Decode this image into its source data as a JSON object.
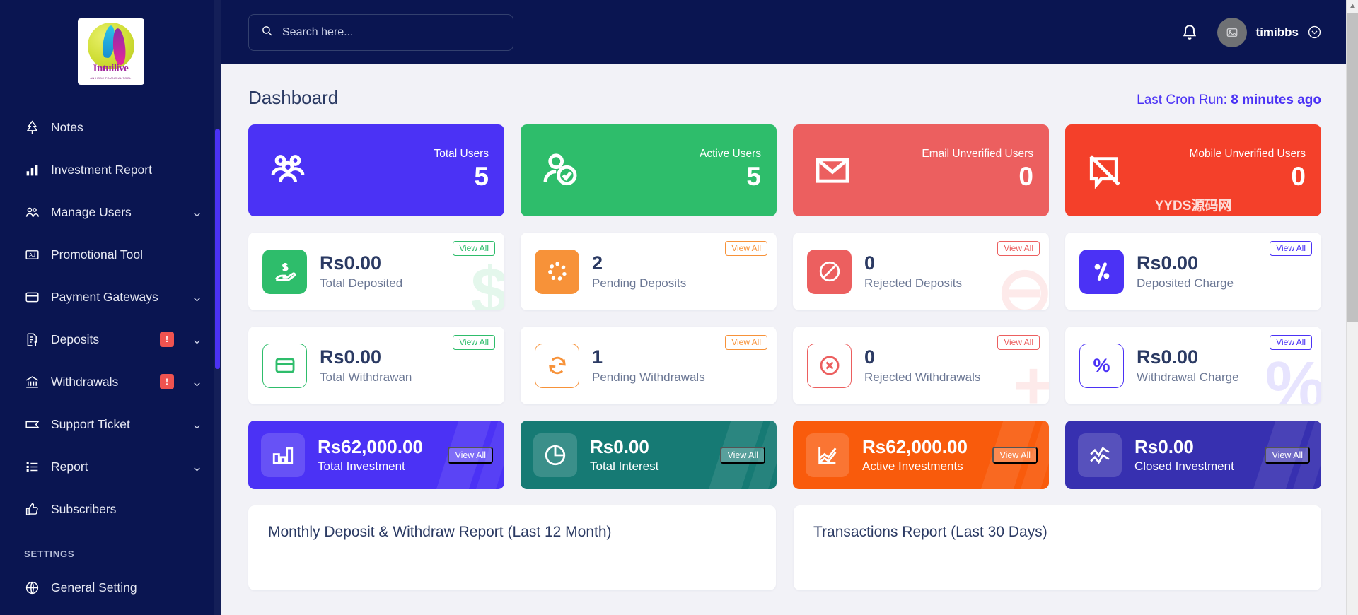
{
  "brand": {
    "logo_text": "Intuilive",
    "logo_sub": "AN HSBC FINANCIAL TOOL"
  },
  "sidebar": {
    "items": [
      {
        "label": "Notes",
        "icon": "tree-icon",
        "badge": null,
        "chevron": false
      },
      {
        "label": "Investment Report",
        "icon": "bar-chart-icon",
        "badge": null,
        "chevron": false
      },
      {
        "label": "Manage Users",
        "icon": "users-icon",
        "badge": null,
        "chevron": true
      },
      {
        "label": "Promotional Tool",
        "icon": "ad-icon",
        "badge": null,
        "chevron": false
      },
      {
        "label": "Payment Gateways",
        "icon": "credit-card-icon",
        "badge": null,
        "chevron": true
      },
      {
        "label": "Deposits",
        "icon": "document-dollar-icon",
        "badge": "!",
        "chevron": true
      },
      {
        "label": "Withdrawals",
        "icon": "bank-icon",
        "badge": "!",
        "chevron": true
      },
      {
        "label": "Support Ticket",
        "icon": "ticket-icon",
        "badge": null,
        "chevron": true
      },
      {
        "label": "Report",
        "icon": "list-icon",
        "badge": null,
        "chevron": true
      },
      {
        "label": "Subscribers",
        "icon": "thumbs-up-icon",
        "badge": null,
        "chevron": false
      }
    ],
    "section_label": "SETTINGS",
    "settings_items": [
      {
        "label": "General Setting",
        "icon": "globe-icon",
        "badge": null,
        "chevron": false
      }
    ]
  },
  "topbar": {
    "search_placeholder": "Search here...",
    "search_value": "",
    "username": "timibbs"
  },
  "page": {
    "title": "Dashboard",
    "cron_label": "Last Cron Run:",
    "cron_value": "8 minutes ago",
    "watermark": "YYDS源码网"
  },
  "colors": {
    "accent": "#4b32f5",
    "sidebar": "#0a1551",
    "green": "#2ebd6b",
    "orange": "#f79239",
    "red": "#ef5350",
    "red_strong": "#f4402a",
    "teal": "#167a74",
    "indigo": "#3730b0"
  },
  "stat_cards_row1": [
    {
      "label": "Total Users",
      "value": "5",
      "icon": "group-users-icon",
      "bg": "#4b32f5"
    },
    {
      "label": "Active Users",
      "value": "5",
      "icon": "user-check-icon",
      "bg": "#2ebd6b"
    },
    {
      "label": "Email Unverified Users",
      "value": "0",
      "icon": "envelope-icon",
      "bg": "#ec5f5f"
    },
    {
      "label": "Mobile Unverified Users",
      "value": "0",
      "icon": "mobile-off-icon",
      "bg": "#f4402a"
    }
  ],
  "stat_cards_row2": [
    {
      "value": "Rs0.00",
      "label": "Total Deposited",
      "view_all": "View All",
      "icon": "hand-dollar-icon",
      "color": "#2ebd6b",
      "filled": true,
      "ghost": "$"
    },
    {
      "value": "2",
      "label": "Pending Deposits",
      "view_all": "View All",
      "icon": "spinner-icon",
      "color": "#f79239",
      "filled": true,
      "ghost": ""
    },
    {
      "value": "0",
      "label": "Rejected Deposits",
      "view_all": "View All",
      "icon": "ban-icon",
      "color": "#ec5f5f",
      "filled": true,
      "ghost": "⊖"
    },
    {
      "value": "Rs0.00",
      "label": "Deposited Charge",
      "view_all": "View All",
      "icon": "percent-icon",
      "color": "#4b32f5",
      "filled": true,
      "ghost": ""
    }
  ],
  "stat_cards_row3": [
    {
      "value": "Rs0.00",
      "label": "Total Withdrawan",
      "view_all": "View All",
      "icon": "card-icon",
      "color": "#2ebd6b",
      "filled": false,
      "ghost": ""
    },
    {
      "value": "1",
      "label": "Pending Withdrawals",
      "view_all": "View All",
      "icon": "refresh-icon",
      "color": "#f79239",
      "filled": false,
      "ghost": ""
    },
    {
      "value": "0",
      "label": "Rejected Withdrawals",
      "view_all": "View All",
      "icon": "circle-x-icon",
      "color": "#ec5f5f",
      "filled": false,
      "ghost": "+"
    },
    {
      "value": "Rs0.00",
      "label": "Withdrawal Charge",
      "view_all": "View All",
      "icon": "percent-outline-icon",
      "color": "#4b32f5",
      "filled": false,
      "ghost": "%"
    }
  ],
  "stat_cards_row4": [
    {
      "value": "Rs62,000.00",
      "label": "Total Investment",
      "view_all": "View All",
      "icon": "bars-icon",
      "bg": "#4b32f5"
    },
    {
      "value": "Rs0.00",
      "label": "Total Interest",
      "view_all": "View All",
      "icon": "pie-icon",
      "bg": "#167a74"
    },
    {
      "value": "Rs62,000.00",
      "label": "Active Investments",
      "view_all": "View All",
      "icon": "chart-up-icon",
      "bg": "#f95b0c"
    },
    {
      "value": "Rs0.00",
      "label": "Closed Investment",
      "view_all": "View All",
      "icon": "zigzag-icon",
      "bg": "#3730b0"
    }
  ],
  "panels": [
    {
      "title": "Monthly Deposit & Withdraw Report (Last 12 Month)"
    },
    {
      "title": "Transactions Report (Last 30 Days)"
    }
  ]
}
